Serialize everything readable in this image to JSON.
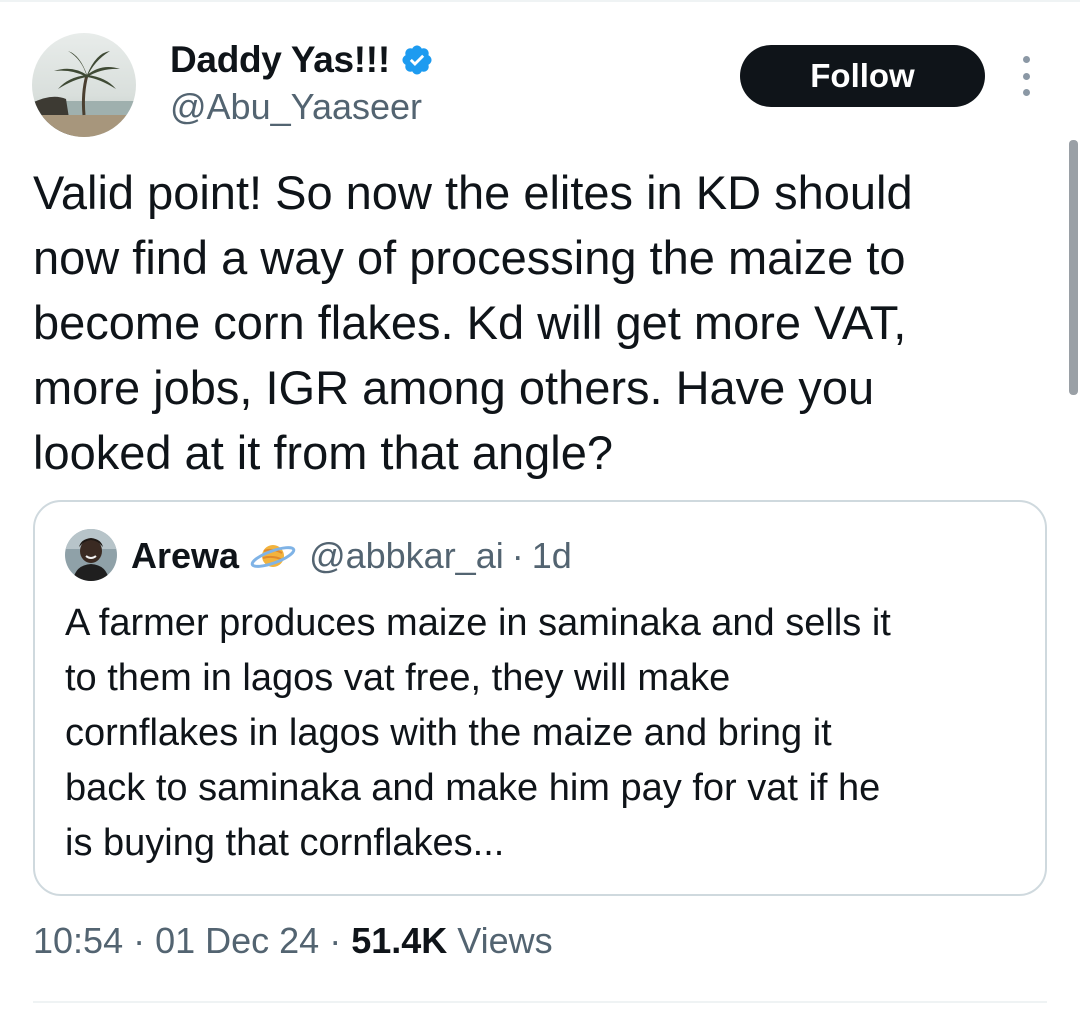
{
  "author": {
    "display_name": "Daddy Yas!!!",
    "handle": "@Abu_Yaaseer",
    "verified": true,
    "avatar_icon": "palm-tree-beach-photo"
  },
  "actions": {
    "follow_label": "Follow",
    "more_icon": "more-vertical-icon"
  },
  "tweet": {
    "text": "Valid point! So now the elites in KD should\nnow find a way of processing the maize to\nbecome corn flakes. Kd will get more VAT,\nmore jobs, IGR among others. Have you\nlooked at it from that angle?"
  },
  "quoted_tweet": {
    "display_name": "Arewa",
    "badge_icon": "planet-emoji-icon",
    "handle": "@abbkar_ai",
    "separator": "·",
    "time": "1d",
    "text": "A farmer produces maize in saminaka and sells it\nto them in lagos vat free, they will make\ncornflakes in lagos with the maize and bring it\nback to saminaka and make him pay for vat if he\nis buying that cornflakes..."
  },
  "meta": {
    "time": "10:54",
    "separator": "·",
    "date": "01 Dec 24",
    "views_count": "51.4K",
    "views_label": "Views"
  },
  "colors": {
    "text_primary": "#0f1419",
    "text_secondary": "#536471",
    "verified_blue": "#1d9bf0",
    "border": "#cfd9de",
    "follow_bg": "#0f1419"
  }
}
